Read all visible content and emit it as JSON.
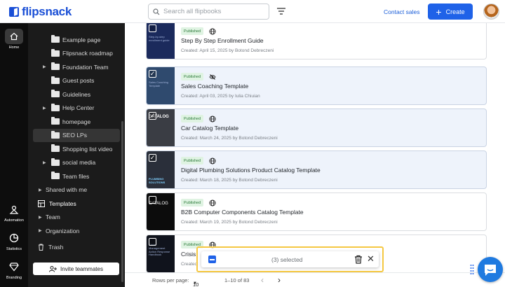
{
  "app": {
    "logo_text": "flipsnack",
    "search_placeholder": "Search all flipbooks",
    "contact_label": "Contact sales",
    "create_label": "Create",
    "brand_color": "#1f62e8"
  },
  "rail": {
    "home": "Home",
    "automation": "Automation",
    "statistics": "Statistics",
    "branding": "Branding"
  },
  "sidebar": {
    "folders": [
      {
        "label": "Example page",
        "chevron": false
      },
      {
        "label": "Flipsnack roadmap",
        "chevron": false
      },
      {
        "label": "Foundation Team",
        "chevron": true
      },
      {
        "label": "Guest posts",
        "chevron": false
      },
      {
        "label": "Guidelines",
        "chevron": false
      },
      {
        "label": "Help Center",
        "chevron": true
      },
      {
        "label": "homepage",
        "chevron": false
      },
      {
        "label": "SEO LPs",
        "chevron": false,
        "selected": true
      },
      {
        "label": "Shopping list video",
        "chevron": false
      },
      {
        "label": "social media",
        "chevron": true
      },
      {
        "label": "Team files",
        "chevron": false
      }
    ],
    "shared": "Shared with me",
    "templates": "Templates",
    "team": "Team",
    "organization": "Organization",
    "trash": "Trash",
    "invite": "Invite teammates"
  },
  "cards": [
    {
      "status": "Published",
      "visibility": "globe-icon",
      "title": "Step By Step Enrollment Guide",
      "meta": "Created: April 15, 2025 by Botond Debreczeni",
      "checked": false,
      "thumb": "Step-by-step enrollment guide"
    },
    {
      "status": "Published",
      "visibility": "eye-off-icon",
      "title": "Sales Coaching Template",
      "meta": "Created: April 03, 2025 by Iulia Chiuian",
      "checked": true,
      "thumb": "Sales Coaching Template"
    },
    {
      "status": "Published",
      "visibility": "globe-icon",
      "title": "Car Catalog Template",
      "meta": "Created: March 24, 2025 by Botond Debreczeni",
      "checked": true,
      "thumb": "CATALOG"
    },
    {
      "status": "Published",
      "visibility": "globe-icon",
      "title": "Digital Plumbing Solutions Product Catalog Template",
      "meta": "Created: March 18, 2025 by Botond Debreczeni",
      "checked": true,
      "thumb": "PLUMBING SOLUTIONS"
    },
    {
      "status": "Published",
      "visibility": "globe-icon",
      "title": "B2B Computer Components Catalog Template",
      "meta": "Created: March 19, 2025 by Botond Debreczeni",
      "checked": false,
      "thumb": "CATALOG"
    },
    {
      "status": "Published",
      "visibility": "globe-icon",
      "title": "Crisis",
      "meta": "Created:",
      "checked": false,
      "thumb": "Crisis Management Action Response Handbook"
    }
  ],
  "footer": {
    "rows_label": "Rows per page:",
    "rows_value": "10",
    "range": "1–10 of 83"
  },
  "selection": {
    "text": "(3) selected"
  }
}
